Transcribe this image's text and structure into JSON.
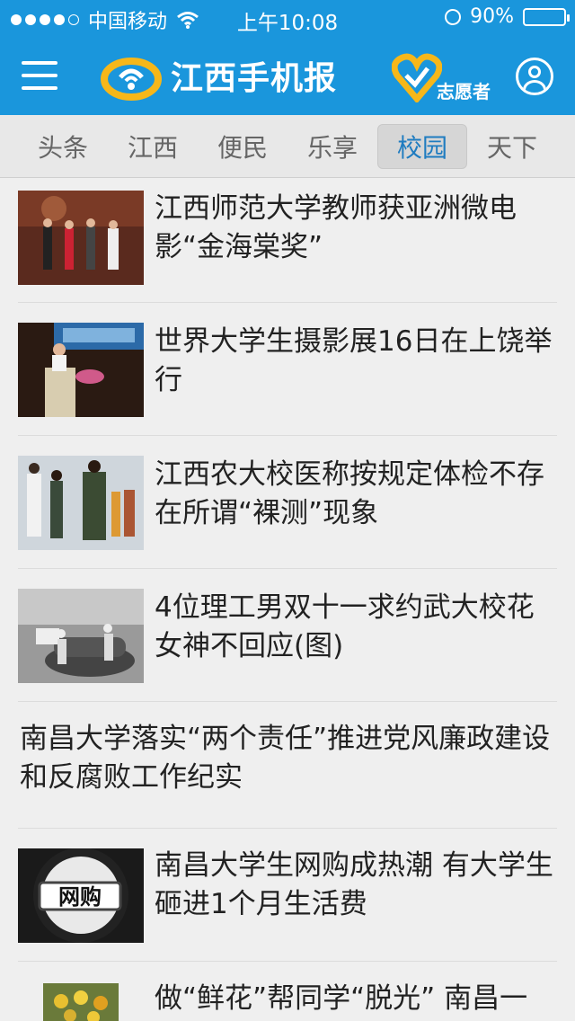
{
  "status_bar": {
    "carrier": "中国移动",
    "time": "上午10:08",
    "battery": "90%",
    "signal_bars": 4,
    "battery_level": 0.9
  },
  "header": {
    "logo_text": "江西手机报",
    "volunteer_label": "志愿者",
    "icons": [
      "menu-icon",
      "logo-icon",
      "volunteer-heart-icon",
      "user-icon"
    ],
    "colors": {
      "bar": "#1a96dc",
      "accent": "#f6b71a",
      "active_tab": "#1f7cc0"
    }
  },
  "tabs": [
    {
      "label": "头条",
      "active": false
    },
    {
      "label": "江西",
      "active": false
    },
    {
      "label": "便民",
      "active": false
    },
    {
      "label": "乐享",
      "active": false
    },
    {
      "label": "校园",
      "active": true
    },
    {
      "label": "天下",
      "active": false
    }
  ],
  "news": [
    {
      "title": "江西师范大学教师获亚洲微电影“金海棠奖”",
      "image": "award-ceremony-photo"
    },
    {
      "title": "世界大学生摄影展16日在上饶举行",
      "image": "speaker-at-podium-photo"
    },
    {
      "title": "江西农大校医称按规定体检不存在所谓“裸测”现象",
      "image": "height-measurement-photo"
    },
    {
      "title": "4位理工男双十一求约武大校花 女神不回应(图)",
      "image": "students-with-car-photo"
    },
    {
      "title": "南昌大学落实“两个责任”推进党风廉政建设和反腐败工作纪实",
      "image": null
    },
    {
      "title": "南昌大学生网购成热潮 有大学生砸进1个月生活费",
      "image": "magnifier-online-shopping-photo"
    },
    {
      "title": "做“鲜花”帮同学“脱光” 南昌一",
      "image": "flowers-photo"
    }
  ]
}
